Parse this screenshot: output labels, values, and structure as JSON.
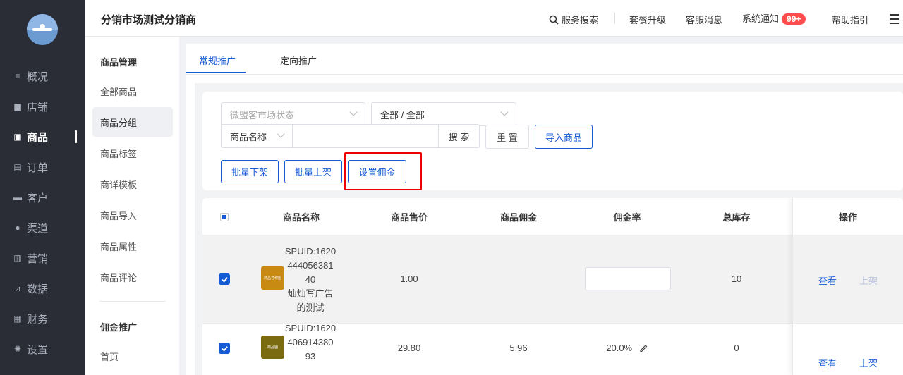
{
  "nav": {
    "items": [
      {
        "label": "概况",
        "icon": "list-icon"
      },
      {
        "label": "店铺",
        "icon": "shop-icon"
      },
      {
        "label": "商品",
        "icon": "goods-icon"
      },
      {
        "label": "订单",
        "icon": "order-icon"
      },
      {
        "label": "客户",
        "icon": "customer-icon"
      },
      {
        "label": "渠道",
        "icon": "channel-icon"
      },
      {
        "label": "营销",
        "icon": "marketing-icon"
      },
      {
        "label": "数据",
        "icon": "data-icon"
      },
      {
        "label": "财务",
        "icon": "finance-icon"
      },
      {
        "label": "设置",
        "icon": "settings-icon"
      }
    ],
    "active": "商品"
  },
  "header": {
    "title": "分销市场测试分销商",
    "search_label": "服务搜索",
    "upgrade_label": "套餐升级",
    "service_msg_label": "客服消息",
    "notice_label": "系统通知",
    "notice_badge": "99+",
    "help_label": "帮助指引"
  },
  "subnav": {
    "group1_title": "商品管理",
    "group1_items": [
      "全部商品",
      "商品分组",
      "商品标签",
      "商详模板",
      "商品导入",
      "商品属性",
      "商品评论"
    ],
    "group1_active": "商品分组",
    "group2_title": "佣金推广",
    "group2_items": [
      "首页"
    ]
  },
  "tabs": {
    "items": [
      "常规推广",
      "定向推广"
    ],
    "active": "常规推广"
  },
  "filters": {
    "status_placeholder": "微盟客市场状态",
    "category_value": "全部 / 全部",
    "field_select": "商品名称",
    "search_button": "搜 索",
    "reset_button": "重 置",
    "import_button": "导入商品"
  },
  "actions": {
    "batch_off": "批量下架",
    "batch_on": "批量上架",
    "set_commission": "设置佣金"
  },
  "table": {
    "columns": [
      "商品名称",
      "商品售价",
      "商品佣金",
      "佣金率",
      "总库存",
      "操作"
    ],
    "rows": [
      {
        "name_lines": [
          "SPUID:1620",
          "444056381",
          "40",
          "灿灿写广告",
          "的测试"
        ],
        "thumb_text": "商品名称图",
        "price": "1.00",
        "commission": "",
        "rate": "",
        "stock": "10",
        "view": "查看",
        "shelf": "上架",
        "checked": true
      },
      {
        "name_lines": [
          "SPUID:1620",
          "406914380",
          "93"
        ],
        "thumb_text": "商品图",
        "price": "29.80",
        "commission": "5.96",
        "rate": "20.0%",
        "stock": "0",
        "view": "查看",
        "shelf": "上架",
        "checked": true
      }
    ]
  },
  "colors": {
    "primary": "#155bd4",
    "sidebar_bg": "#2a2d36",
    "badge": "#ff4d4f",
    "highlight_box": "#ee0000",
    "thumb1": "#c98a14",
    "thumb2": "#7a6a10"
  }
}
